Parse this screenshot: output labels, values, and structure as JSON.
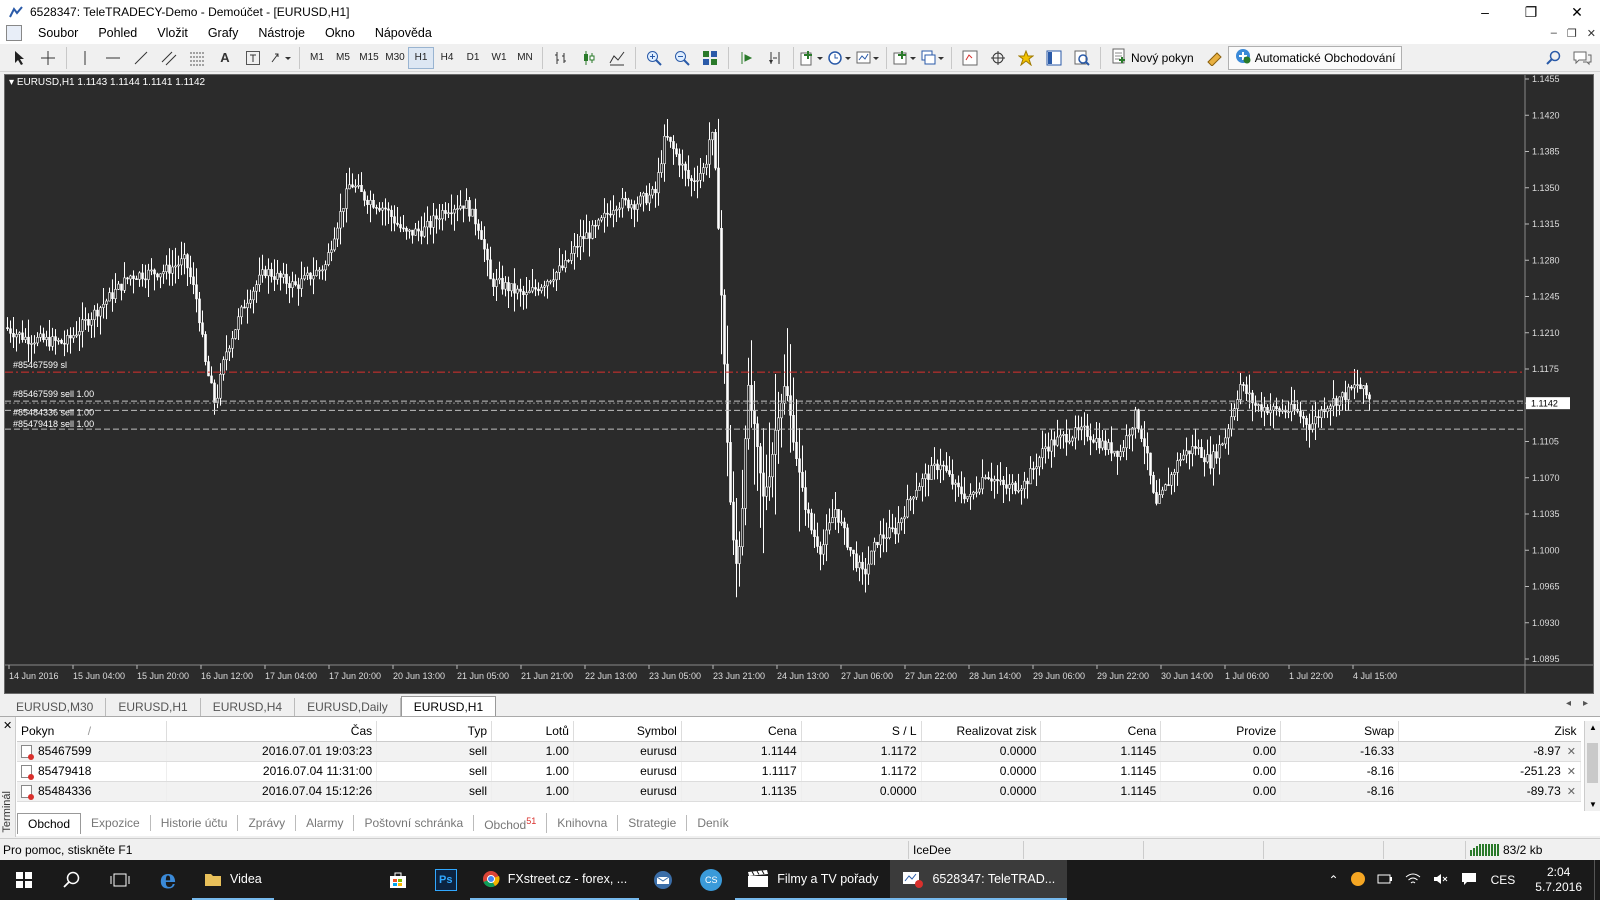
{
  "window": {
    "title": "6528347: TeleTRADECY-Demo - Demoúčet - [EURUSD,H1]",
    "controls": [
      "–",
      "❐",
      "✕"
    ]
  },
  "menu": {
    "items": [
      "Soubor",
      "Pohled",
      "Vložit",
      "Grafy",
      "Nástroje",
      "Okno",
      "Nápověda"
    ]
  },
  "toolbar": {
    "timeframes": [
      "M1",
      "M5",
      "M15",
      "M30",
      "H1",
      "H4",
      "D1",
      "W1",
      "MN"
    ],
    "active_timeframe": "H1",
    "new_order_label": "Nový pokyn",
    "auto_trading_label": "Automatické Obchodování"
  },
  "chart": {
    "header": "EURUSD,H1  1.1143 1.1144 1.1141 1.1142",
    "current_price": "1.1142",
    "price_ticks": [
      "1.1455",
      "1.1420",
      "1.1385",
      "1.1350",
      "1.1315",
      "1.1280",
      "1.1245",
      "1.1210",
      "1.1175",
      "1.1142",
      "1.1105",
      "1.1070",
      "1.1035",
      "1.1000",
      "1.0965",
      "1.0930",
      "1.0895"
    ],
    "time_ticks": [
      "14 Jun 2016",
      "15 Jun 04:00",
      "15 Jun 20:00",
      "16 Jun 12:00",
      "17 Jun 04:00",
      "17 Jun 20:00",
      "20 Jun 13:00",
      "21 Jun 05:00",
      "21 Jun 21:00",
      "22 Jun 13:00",
      "23 Jun 05:00",
      "23 Jun 21:00",
      "24 Jun 13:00",
      "27 Jun 06:00",
      "27 Jun 22:00",
      "28 Jun 14:00",
      "29 Jun 06:00",
      "29 Jun 22:00",
      "30 Jun 14:00",
      "1 Jul 06:00",
      "1 Jul 22:00",
      "4 Jul 15:00"
    ],
    "order_lines": [
      {
        "label": "#85467599 sl",
        "price": 1.1172,
        "color": "#d9302c"
      },
      {
        "label": "#85467599 sell 1.00",
        "price": 1.1144,
        "color": "#c0c0c0"
      },
      {
        "label": "#85484336 sell 1.00",
        "price": 1.1135,
        "color": "#c0c0c0"
      },
      {
        "label": "#85479418 sell 1.00",
        "price": 1.1117,
        "color": "#c0c0c0"
      }
    ],
    "colors": {
      "background": "#2b2b2b",
      "candles": "#ffffff",
      "stop_loss": "#d9302c",
      "order": "#c0c0c0",
      "price_label_bg": "#ffffff"
    }
  },
  "chart_tabs": [
    "EURUSD,M30",
    "EURUSD,H1",
    "EURUSD,H4",
    "EURUSD,Daily",
    "EURUSD,H1"
  ],
  "active_chart_tab": 4,
  "terminal": {
    "side_label": "Terminál",
    "columns": [
      "Pokyn",
      "Čas",
      "Typ",
      "Lotů",
      "Symbol",
      "Cena",
      "S / L",
      "Realizovat zisk",
      "Cena",
      "Provize",
      "Swap",
      "Zisk"
    ],
    "rows": [
      [
        "85467599",
        "2016.07.01 19:03:23",
        "sell",
        "1.00",
        "eurusd",
        "1.1144",
        "1.1172",
        "0.0000",
        "1.1145",
        "0.00",
        "-16.33",
        "-8.97"
      ],
      [
        "85479418",
        "2016.07.04 11:31:00",
        "sell",
        "1.00",
        "eurusd",
        "1.1117",
        "1.1172",
        "0.0000",
        "1.1145",
        "0.00",
        "-8.16",
        "-251.23"
      ],
      [
        "85484336",
        "2016.07.04 15:12:26",
        "sell",
        "1.00",
        "eurusd",
        "1.1135",
        "0.0000",
        "0.0000",
        "1.1145",
        "0.00",
        "-8.16",
        "-89.73"
      ]
    ],
    "tabs": [
      "Obchod",
      "Expozice",
      "Historie účtu",
      "Zprávy",
      "Alarmy",
      "Poštovní schránka",
      "Obchod",
      "Knihovna",
      "Strategie",
      "Deník"
    ],
    "market_badge": "51"
  },
  "status": {
    "help": "Pro pomoc, stiskněte F1",
    "profile": "IceDee",
    "traffic": "83/2 kb"
  },
  "taskbar": {
    "apps": [
      "Videa",
      "FXstreet.cz - forex, ...",
      "Filmy a TV pořady",
      "6528347: TeleTRAD..."
    ],
    "language": "CES",
    "time": "2:04",
    "date": "5.7.2016"
  }
}
